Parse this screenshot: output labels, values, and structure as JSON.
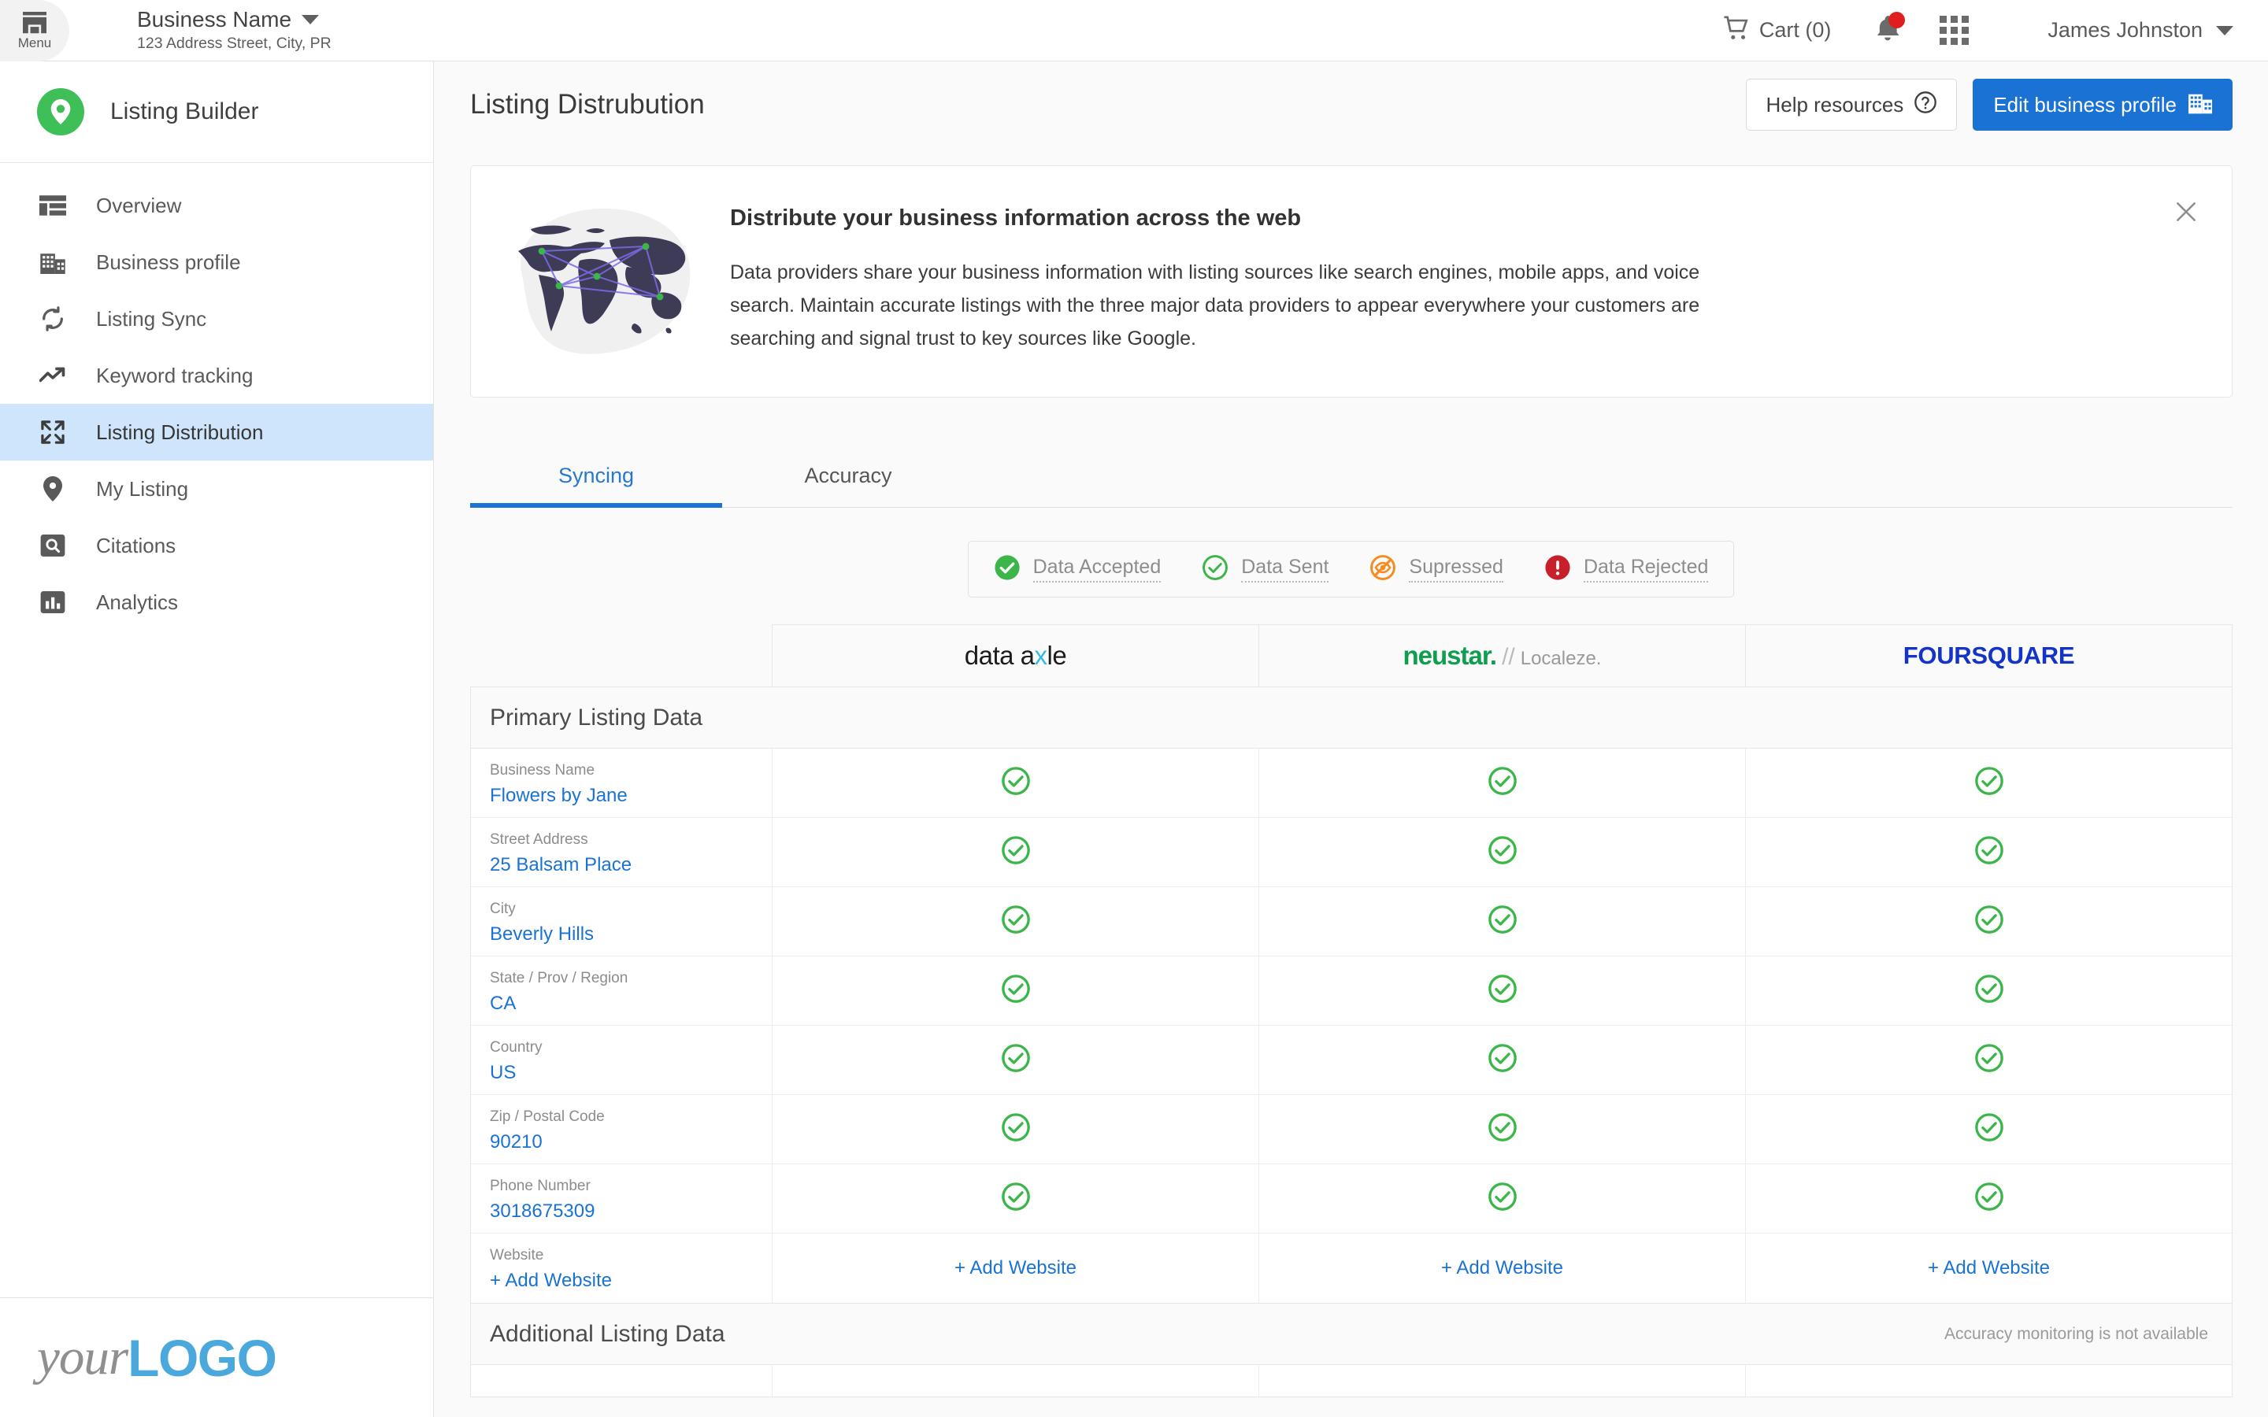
{
  "topbar": {
    "menu_label": "Menu",
    "menu_icon": "storefront-icon",
    "business_name": "Business Name",
    "business_address": "123 Address Street, City, PR",
    "cart_label": "Cart (0)",
    "cart_icon": "shopping-cart-icon",
    "notifications_icon": "bell-icon",
    "apps_icon": "grid-apps-icon",
    "user_name": "James Johnston"
  },
  "sidebar": {
    "brand": "Listing Builder",
    "brand_icon": "map-pin-icon",
    "items": [
      {
        "label": "Overview",
        "icon": "dashboard-icon",
        "active": false
      },
      {
        "label": "Business profile",
        "icon": "building-icon",
        "active": false
      },
      {
        "label": "Listing Sync",
        "icon": "sync-icon",
        "active": false
      },
      {
        "label": "Keyword tracking",
        "icon": "trending-up-icon",
        "active": false
      },
      {
        "label": "Listing Distribution",
        "icon": "expand-icon",
        "active": true
      },
      {
        "label": "My Listing",
        "icon": "map-pin-icon",
        "active": false
      },
      {
        "label": "Citations",
        "icon": "search-box-icon",
        "active": false
      },
      {
        "label": "Analytics",
        "icon": "bar-chart-icon",
        "active": false
      }
    ],
    "footer_logo_light": "your",
    "footer_logo_bold": "LOGO"
  },
  "page": {
    "title": "Listing Distrubution",
    "help_label": "Help resources",
    "help_icon": "question-circle-icon",
    "edit_label": "Edit business profile",
    "edit_icon": "building-icon"
  },
  "banner": {
    "title": "Distribute your business information across the web",
    "body": "Data providers share your business information with listing sources like search engines, mobile apps, and voice search. Maintain accurate listings with the three major data providers to appear everywhere your customers are searching and signal trust to key sources like Google.",
    "image": "world-map-network-illustration",
    "close_icon": "close-icon"
  },
  "tabs": [
    {
      "label": "Syncing",
      "active": true
    },
    {
      "label": "Accuracy",
      "active": false
    }
  ],
  "legend": [
    {
      "label": "Data Accepted",
      "icon": "check-filled-icon",
      "color": "#3cb54a"
    },
    {
      "label": "Data Sent",
      "icon": "check-outline-icon",
      "color": "#3cb54a"
    },
    {
      "label": "Supressed",
      "icon": "eye-off-icon",
      "color": "#f68b1f"
    },
    {
      "label": "Data Rejected",
      "icon": "exclamation-filled-icon",
      "color": "#c8202a"
    }
  ],
  "providers": [
    {
      "name": "data axle",
      "part1": "data a",
      "accent": "x",
      "part2": "le"
    },
    {
      "name": "neustar // Localeze.",
      "part1": "neustar.",
      "slash": "//",
      "part2": "Localeze."
    },
    {
      "name": "FOURSQUARE"
    }
  ],
  "table": {
    "primary_section_title": "Primary Listing Data",
    "additional_section_title": "Additional Listing Data",
    "additional_section_note": "Accuracy monitoring is not available",
    "add_website_label": "+ Add Website",
    "rows": [
      {
        "label": "Business Name",
        "value": "Flowers by Jane",
        "statuses": [
          "check",
          "check",
          "check"
        ]
      },
      {
        "label": "Street Address",
        "value": "25 Balsam Place",
        "statuses": [
          "check",
          "check",
          "check"
        ]
      },
      {
        "label": "City",
        "value": "Beverly Hills",
        "statuses": [
          "check",
          "check",
          "check"
        ]
      },
      {
        "label": "State / Prov / Region",
        "value": "CA",
        "statuses": [
          "check",
          "check",
          "check"
        ]
      },
      {
        "label": "Country",
        "value": "US",
        "statuses": [
          "check",
          "check",
          "check"
        ]
      },
      {
        "label": "Zip / Postal Code",
        "value": "90210",
        "statuses": [
          "check",
          "check",
          "check"
        ]
      },
      {
        "label": "Phone Number",
        "value": "3018675309",
        "statuses": [
          "check",
          "check",
          "check"
        ]
      },
      {
        "label": "Website",
        "value": "+ Add Website",
        "statuses": [
          "add",
          "add",
          "add"
        ]
      }
    ]
  },
  "colors": {
    "accent_blue": "#1a73d4",
    "link_blue": "#1a73d4",
    "success_green": "#3cb54a",
    "warn_orange": "#f68b1f",
    "error_red": "#c8202a",
    "active_nav": "#cfe5fb",
    "brand_green": "#3fbf57"
  }
}
